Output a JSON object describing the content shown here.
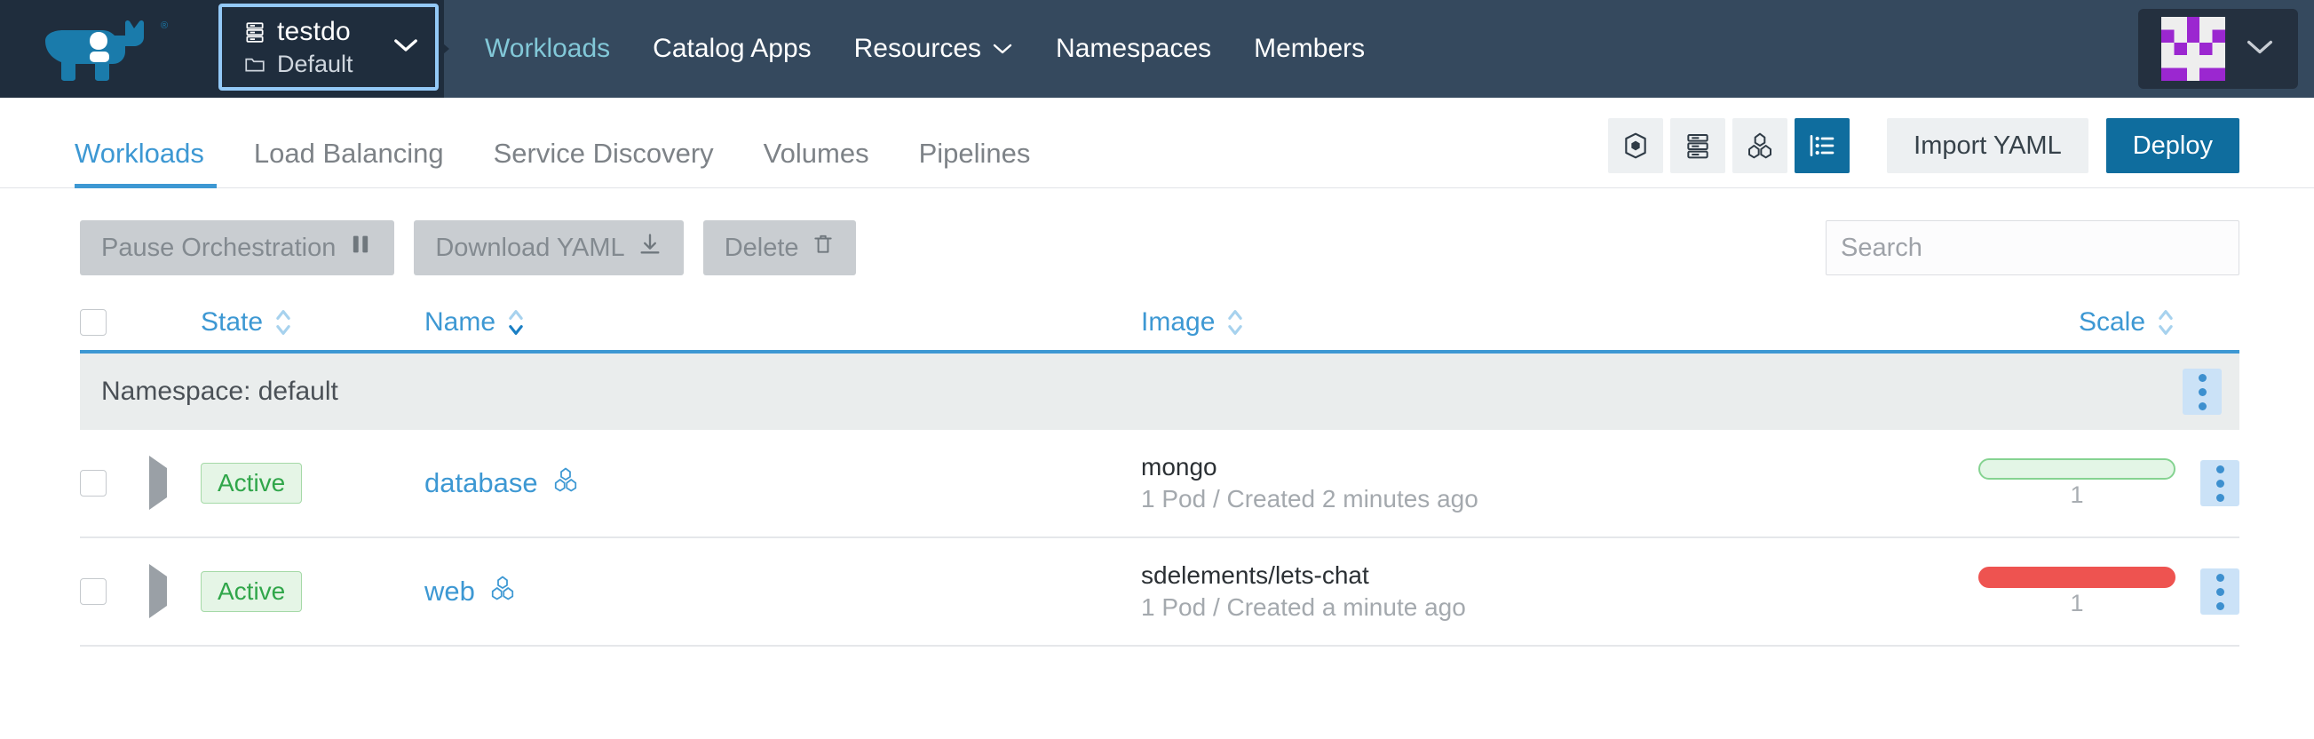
{
  "header": {
    "logo_name": "rancher-logo",
    "cluster_picker": {
      "cluster_name": "testdo",
      "project_name": "Default",
      "cluster_icon": "server-icon",
      "project_icon": "folder-icon",
      "chevron": "chevron-down-icon"
    },
    "nav_items": [
      {
        "label": "Workloads",
        "active": true,
        "has_caret": false
      },
      {
        "label": "Catalog Apps",
        "active": false,
        "has_caret": false
      },
      {
        "label": "Resources",
        "active": false,
        "has_caret": true
      },
      {
        "label": "Namespaces",
        "active": false,
        "has_caret": false
      },
      {
        "label": "Members",
        "active": false,
        "has_caret": false
      }
    ],
    "avatar": {
      "name": "user-avatar-identicon",
      "chevron": "chevron-down-icon"
    }
  },
  "subnav": {
    "tabs": [
      {
        "label": "Workloads",
        "active": true
      },
      {
        "label": "Load Balancing",
        "active": false
      },
      {
        "label": "Service Discovery",
        "active": false
      },
      {
        "label": "Volumes",
        "active": false
      },
      {
        "label": "Pipelines",
        "active": false
      }
    ],
    "view_toggles": [
      {
        "name": "workload-view-icon",
        "active": false
      },
      {
        "name": "node-view-icon",
        "active": false
      },
      {
        "name": "cluster-view-icon",
        "active": false
      },
      {
        "name": "list-view-icon",
        "active": true
      }
    ],
    "import_yaml_label": "Import YAML",
    "deploy_label": "Deploy"
  },
  "actions": {
    "pause_label": "Pause Orchestration",
    "pause_icon": "pause-icon",
    "download_label": "Download YAML",
    "download_icon": "download-icon",
    "delete_label": "Delete",
    "delete_icon": "trash-icon",
    "search_placeholder": "Search",
    "search_value": ""
  },
  "table": {
    "columns": [
      {
        "key": "state",
        "label": "State",
        "sortable": true,
        "sorted": "none"
      },
      {
        "key": "name",
        "label": "Name",
        "sortable": true,
        "sorted": "desc"
      },
      {
        "key": "image",
        "label": "Image",
        "sortable": true,
        "sorted": "none"
      },
      {
        "key": "scale",
        "label": "Scale",
        "sortable": true,
        "sorted": "none"
      }
    ],
    "group_label": "Namespace: default",
    "group_menu_icon": "kebab-menu-icon",
    "rows": [
      {
        "checked": false,
        "expand_icon": "expand-triangle-icon",
        "state": "Active",
        "name": "database",
        "name_icon": "workload-cubes-icon",
        "image": "mongo",
        "image_sub": "1 Pod / Created 2 minutes ago",
        "scale_count": "1",
        "scale_status": "ok",
        "menu_icon": "kebab-menu-icon"
      },
      {
        "checked": false,
        "expand_icon": "expand-triangle-icon",
        "state": "Active",
        "name": "web",
        "name_icon": "workload-cubes-icon",
        "image": "sdelements/lets-chat",
        "image_sub": "1 Pod / Created a minute ago",
        "scale_count": "1",
        "scale_status": "fail",
        "menu_icon": "kebab-menu-icon"
      }
    ]
  },
  "colors": {
    "nav_bg": "#35495e",
    "nav_dark": "#1f2d3d",
    "accent_blue": "#3d98d3",
    "primary_blue": "#0f6d9e",
    "active_teal": "#82c8d8",
    "success_green": "#30a64a",
    "error_red": "#ee5350",
    "avatar_purple": "#9b27d0"
  }
}
